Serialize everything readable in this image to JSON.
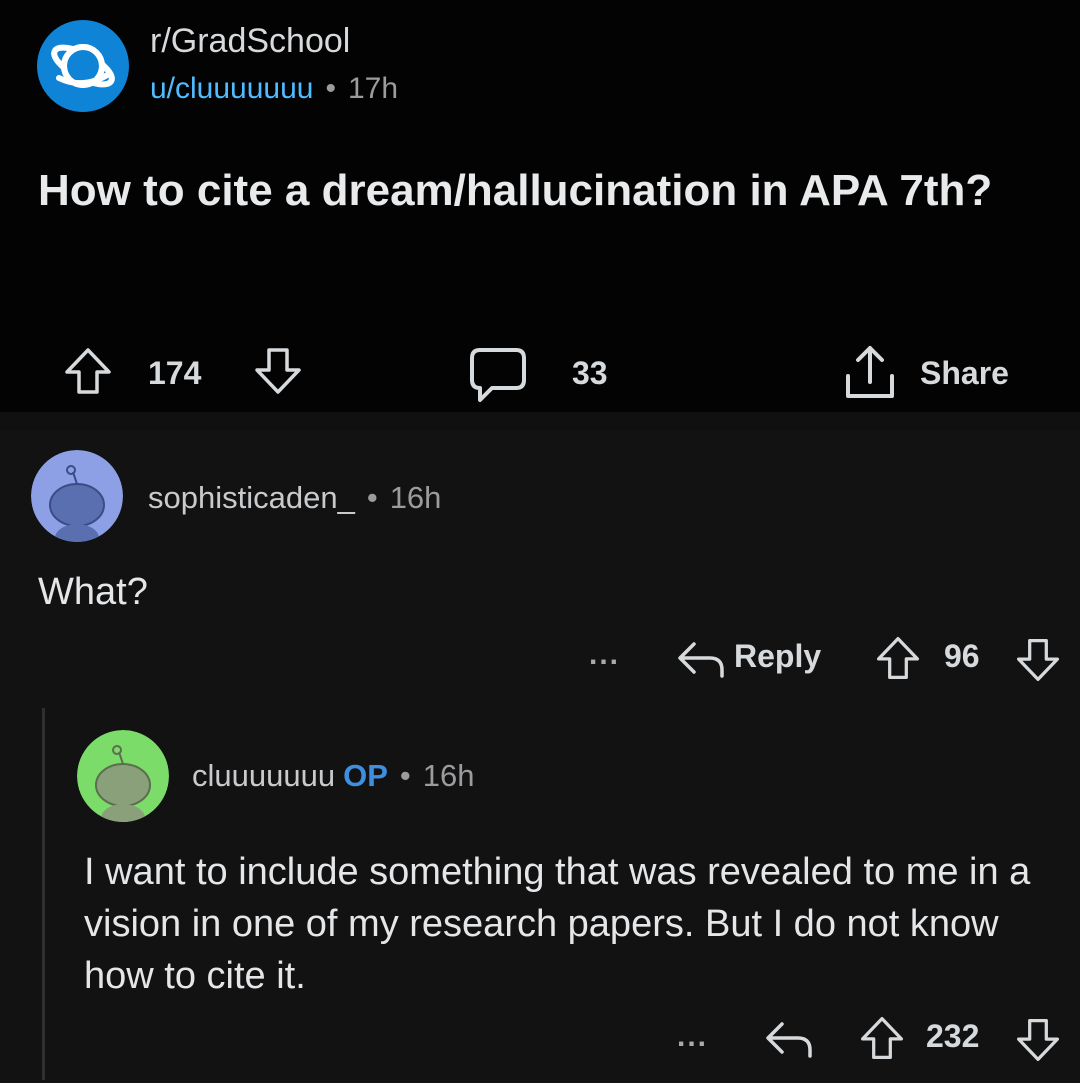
{
  "post": {
    "subreddit": "r/GradSchool",
    "author": "u/cluuuuuuu",
    "separator": "•",
    "age": "17h",
    "title": "How to cite a dream/hallucination in APA 7th?",
    "upvotes": "174",
    "comments": "33",
    "share_label": "Share",
    "icons": [
      "planet-icon",
      "upvote-icon",
      "downvote-icon",
      "comment-icon",
      "share-icon"
    ]
  },
  "comments": [
    {
      "username": "sophisticaden_",
      "separator": "•",
      "age": "16h",
      "body": "What?",
      "more_label": "...",
      "reply_label": "Reply",
      "score": "96",
      "avatar_color": "#8da0e6"
    },
    {
      "username": "cluuuuuuu",
      "op_label": "OP",
      "separator": "•",
      "age": "16h",
      "body": "I want to include something that was revealed to me in a vision in one of my research papers. But I do not know how to cite it.",
      "more_label": "...",
      "score": "232",
      "avatar_color": "#7cdc6a"
    }
  ],
  "colors": {
    "background": "#030303",
    "comment_background": "#121213",
    "subreddit_icon": "#0f84d6",
    "author_link": "#4fbcff",
    "op_badge": "#3f8fe0",
    "text": "#d7dadc",
    "muted": "#9a9c9e"
  }
}
